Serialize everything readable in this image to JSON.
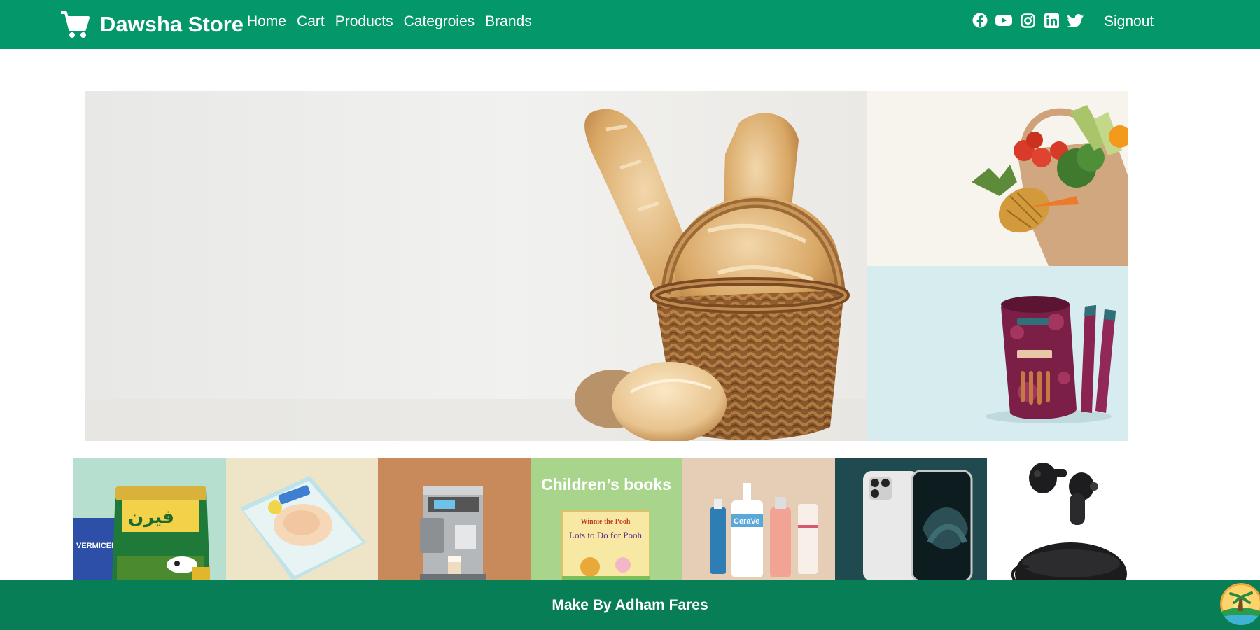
{
  "navbar": {
    "brand": "Dawsha Store",
    "brand_icon": "cart-icon",
    "links": [
      "Home",
      "Cart",
      "Products",
      "Categroies",
      "Brands"
    ],
    "social_icons": [
      "facebook-icon",
      "youtube-icon",
      "instagram-icon",
      "linkedin-icon",
      "twitter-icon"
    ],
    "signout": "Signout",
    "bg_color": "#04976a"
  },
  "hero": {
    "main_image": "bread-basket",
    "side_images": [
      "grocery-bag",
      "red-velvet-wafer-rolls"
    ]
  },
  "categories": {
    "tiles": [
      "grocery",
      "diapers",
      "coffee-machine",
      "books",
      "skincare",
      "phone",
      "earbuds"
    ],
    "books_title": "Children’s books",
    "book_cover_title": "Lots to Do for Pooh",
    "book_cover_brand": "Winnie the Pooh",
    "grocery_label": "VERMICELLI"
  },
  "footer": {
    "text": "Make By Adham Fares",
    "bg_color": "#087e57"
  }
}
